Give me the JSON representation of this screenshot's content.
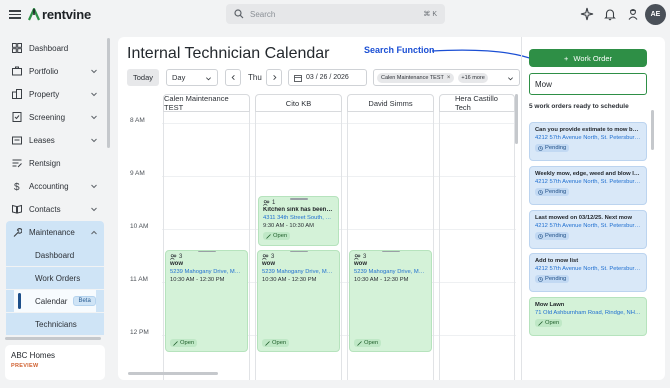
{
  "app": {
    "name": "rentvine",
    "user_initials": "AE"
  },
  "search": {
    "placeholder": "Search",
    "shortcut": "⌘ K"
  },
  "sidebar": {
    "items": [
      {
        "label": "Dashboard",
        "icon": "dashboard-icon"
      },
      {
        "label": "Portfolio",
        "icon": "portfolio-icon"
      },
      {
        "label": "Property",
        "icon": "property-icon"
      },
      {
        "label": "Screening",
        "icon": "screening-icon"
      },
      {
        "label": "Leases",
        "icon": "leases-icon"
      },
      {
        "label": "Rentsign",
        "icon": "rentsign-icon"
      },
      {
        "label": "Accounting",
        "icon": "dollar-icon"
      },
      {
        "label": "Contacts",
        "icon": "contacts-icon"
      },
      {
        "label": "Maintenance",
        "icon": "wrench-icon"
      }
    ],
    "maintenance_sub": [
      {
        "label": "Dashboard"
      },
      {
        "label": "Work Orders"
      },
      {
        "label": "Calendar",
        "badge": "Beta"
      },
      {
        "label": "Technicians"
      }
    ],
    "org": {
      "name": "ABC Homes",
      "tag": "PREVIEW"
    }
  },
  "page": {
    "title": "Internal Technician Calendar",
    "annotation": "Search Function"
  },
  "toolbar": {
    "today": "Today",
    "view": "Day",
    "day": "Thu",
    "date": "03 / 26 / 2026",
    "tech_chip": "Calen Maintenance TEST",
    "chip_remove": "×",
    "more": "+16 more"
  },
  "calendar": {
    "columns": [
      "Calen Maintenance TEST",
      "Cito KB",
      "David Simms",
      "Hera Castillo Tech"
    ],
    "times": [
      "8 AM",
      "9 AM",
      "10 AM",
      "11 AM",
      "12 PM"
    ],
    "events": [
      {
        "count": "1",
        "title": "Kitchen sink has been drain...",
        "address": "4311 34th Street South, St. P...",
        "time": "9:30 AM - 10:30 AM",
        "status": "Open"
      },
      {
        "count": "3",
        "title": "wow",
        "address": "5239 Mahogany Drive, Mou...",
        "time": "10:30 AM - 12:30 PM",
        "status": "Open"
      },
      {
        "count": "3",
        "title": "wow",
        "address": "5239 Mahogany Drive, Mou...",
        "time": "10:30 AM - 12:30 PM",
        "status": "Open"
      },
      {
        "count": "3",
        "title": "wow",
        "address": "5239 Mahogany Drive, Mou...",
        "time": "10:30 AM - 12:30 PM",
        "status": "Open"
      }
    ]
  },
  "work_orders": {
    "button": "Work Order",
    "search_value": "Mow",
    "ready_label": "5 work orders ready to schedule",
    "items": [
      {
        "title": "Can you provide estimate to mow back...",
        "address": "4212 57th Avenue North, St. Petersburg,...",
        "status": "Pending"
      },
      {
        "title": "Weekly mow, edge, weed and blow Inv...",
        "address": "4212 57th Avenue North, St. Petersburg,...",
        "status": "Pending"
      },
      {
        "title": "Last mowed on 03/12/25. Next mow",
        "address": "4212 57th Avenue North, St. Petersburg,...",
        "status": "Pending"
      },
      {
        "title": "Add to mow list",
        "address": "4212 57th Avenue North, St. Petersburg,...",
        "status": "Pending"
      },
      {
        "title": "Mow Lawn",
        "address": "71 Old Ashburnham Road, Rindge, NH 0...",
        "status": "Open"
      }
    ]
  },
  "colors": {
    "accent_green": "#2e8f46",
    "nav_active": "#cfe4f6",
    "annotation_blue": "#1b4fd4",
    "pending_bg": "#d9e8f8",
    "open_bg": "#d4f2d8"
  }
}
